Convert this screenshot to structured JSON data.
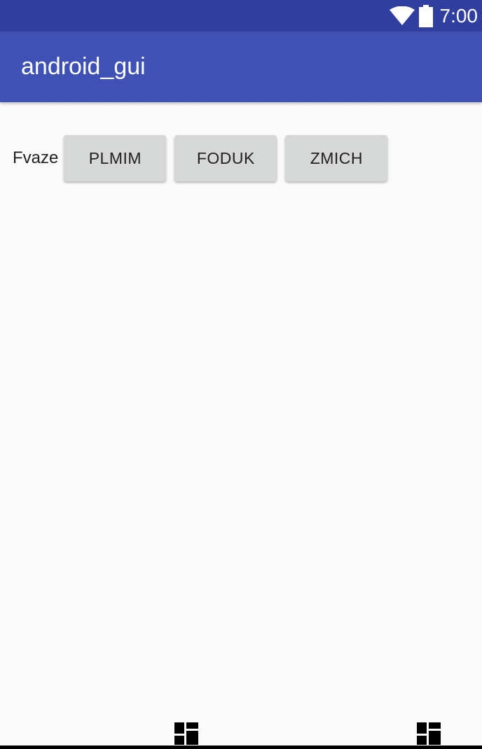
{
  "status_bar": {
    "time": "7:00",
    "icons": [
      "wifi-icon",
      "battery-icon"
    ],
    "color": "#303f9f"
  },
  "app_bar": {
    "title": "android_gui",
    "color": "#3f51b5"
  },
  "row": {
    "label": "Fvaze",
    "buttons": [
      {
        "label": "PLMIM"
      },
      {
        "label": "FODUK"
      },
      {
        "label": "ZMICH"
      }
    ]
  },
  "nav_bar": {
    "icons": [
      "dashboard-icon",
      "dashboard-icon"
    ]
  }
}
